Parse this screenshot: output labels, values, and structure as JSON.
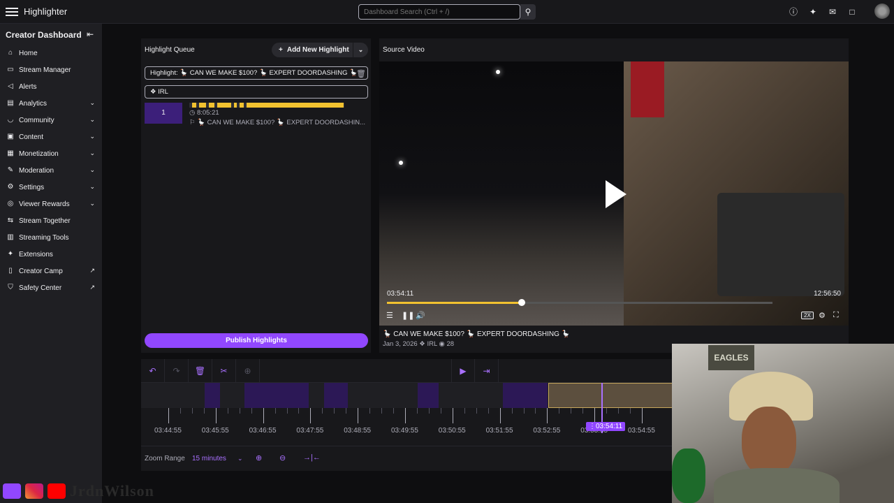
{
  "app": {
    "title": "Highlighter"
  },
  "search": {
    "placeholder": "Dashboard Search (Ctrl + /)"
  },
  "sidebar": {
    "heading": "Creator Dashboard",
    "items": [
      {
        "label": "Home",
        "icon": "home-icon"
      },
      {
        "label": "Stream Manager",
        "icon": "stream-manager-icon"
      },
      {
        "label": "Alerts",
        "icon": "megaphone-icon"
      },
      {
        "label": "Analytics",
        "icon": "analytics-icon",
        "expandable": true
      },
      {
        "label": "Community",
        "icon": "community-icon",
        "expandable": true
      },
      {
        "label": "Content",
        "icon": "content-icon",
        "expandable": true
      },
      {
        "label": "Monetization",
        "icon": "monetization-icon",
        "expandable": true
      },
      {
        "label": "Moderation",
        "icon": "moderation-icon",
        "expandable": true
      },
      {
        "label": "Settings",
        "icon": "settings-icon",
        "expandable": true
      },
      {
        "label": "Viewer Rewards",
        "icon": "rewards-icon",
        "expandable": true
      },
      {
        "label": "Stream Together",
        "icon": "stream-together-icon"
      },
      {
        "label": "Streaming Tools",
        "icon": "streaming-tools-icon"
      },
      {
        "label": "Extensions",
        "icon": "extensions-icon"
      },
      {
        "label": "Creator Camp",
        "icon": "creator-camp-icon",
        "external": true
      },
      {
        "label": "Safety Center",
        "icon": "safety-center-icon",
        "external": true
      }
    ]
  },
  "queue": {
    "title": "Highlight Queue",
    "add_label": "Add New Highlight",
    "highlight_title": "Highlight: 🪿 CAN WE MAKE $100? 🪿 EXPERT DOORDASHING 🪿",
    "category": "IRL",
    "item": {
      "number": "1",
      "duration": "8:05:21",
      "name": "🪿 CAN WE MAKE $100? 🪿 EXPERT DOORDASHIN..."
    },
    "publish_label": "Publish Highlights"
  },
  "source": {
    "title": "Source Video",
    "current_time": "03:54:11",
    "total_time": "12:56:50",
    "progress": 0.35,
    "buffered": 1.0,
    "speed_badge": "2X",
    "video_name": "🪿 CAN WE MAKE $100? 🪿 EXPERT DOORDASHING 🪿",
    "date": "Jan 3, 2026",
    "category": "IRL",
    "views": "28"
  },
  "timeline": {
    "ticks": [
      "03:44:55",
      "03:45:55",
      "03:46:55",
      "03:47:55",
      "03:48:55",
      "03:49:55",
      "03:50:55",
      "03:51:55",
      "03:52:55",
      "03:53:55",
      "03:54:55"
    ],
    "playhead_label": "03:54:11",
    "zoom_label": "Zoom Range",
    "zoom_value": "15 minutes"
  },
  "branding": {
    "name": "JrdnWilson"
  },
  "colors": {
    "accent": "#9147ff",
    "accent_light": "#a970ff",
    "highlight": "#f2c230",
    "bg": "#0e0e10",
    "panel": "#18181b"
  }
}
